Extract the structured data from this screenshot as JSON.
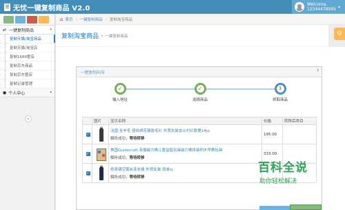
{
  "app": {
    "title": "无忧一键复制商品 V2.0"
  },
  "user": {
    "welcome": "Welcome,",
    "name": "12344478995"
  },
  "sidebar": {
    "group1": {
      "label": "一键复制商品",
      "items": [
        {
          "label": "复制天猫/淘宝商品",
          "active": true
        },
        {
          "label": "复制天猫/淘宝店"
        },
        {
          "label": "复制1688整店"
        },
        {
          "label": "复制京东商品"
        },
        {
          "label": "复制京东整店"
        },
        {
          "label": "复制记录管理"
        }
      ]
    },
    "group2": {
      "label": "个人中心"
    }
  },
  "breadcrumb": {
    "home": "首页",
    "level1": "一键复制商品",
    "level2": "复制淘宝商品"
  },
  "page": {
    "title": "复制淘宝商品",
    "subtitle": "一键复制商品"
  },
  "wizard": {
    "title": "一键复制向导",
    "help": "?",
    "steps": [
      {
        "label": "输入地址",
        "state": "done",
        "mark": "✓"
      },
      {
        "label": "选择商品",
        "state": "done",
        "mark": "✓"
      },
      {
        "label": "抓取商品",
        "state": "current",
        "mark": "3"
      }
    ]
  },
  "table": {
    "headers": [
      "",
      "图片",
      "宝贝名称",
      "价格",
      "转移后类目"
    ],
    "rows": [
      {
        "name": "法国 全羊毛 竖纹绣花镂款毛衫 外贸女装女士衬衫款第14jq",
        "status_prefix": "解析成功，",
        "status_suffix": "等待转移",
        "price": "195.00",
        "category": ""
      },
      {
        "name": "美国Guidecraft 亲撰磁力棒儿童益智玩具磁力棒拼装积木早教玩具",
        "status_prefix": "解析成功，",
        "status_suffix": "等待转移",
        "price": "333.00",
        "category": ""
      },
      {
        "name": "修身镂空蕾丝连衣裙 外贸女装 原单sj",
        "status_prefix": "解析成功，",
        "status_suffix": "等待转移",
        "price": "",
        "category": ""
      }
    ]
  },
  "watermark": {
    "big": "百科全说",
    "small": "助你轻松解决"
  },
  "colors": {
    "topbar": "#438eb9",
    "accent": "#2679b5",
    "step_done": "#72b056",
    "watermark": "#2aa654"
  }
}
